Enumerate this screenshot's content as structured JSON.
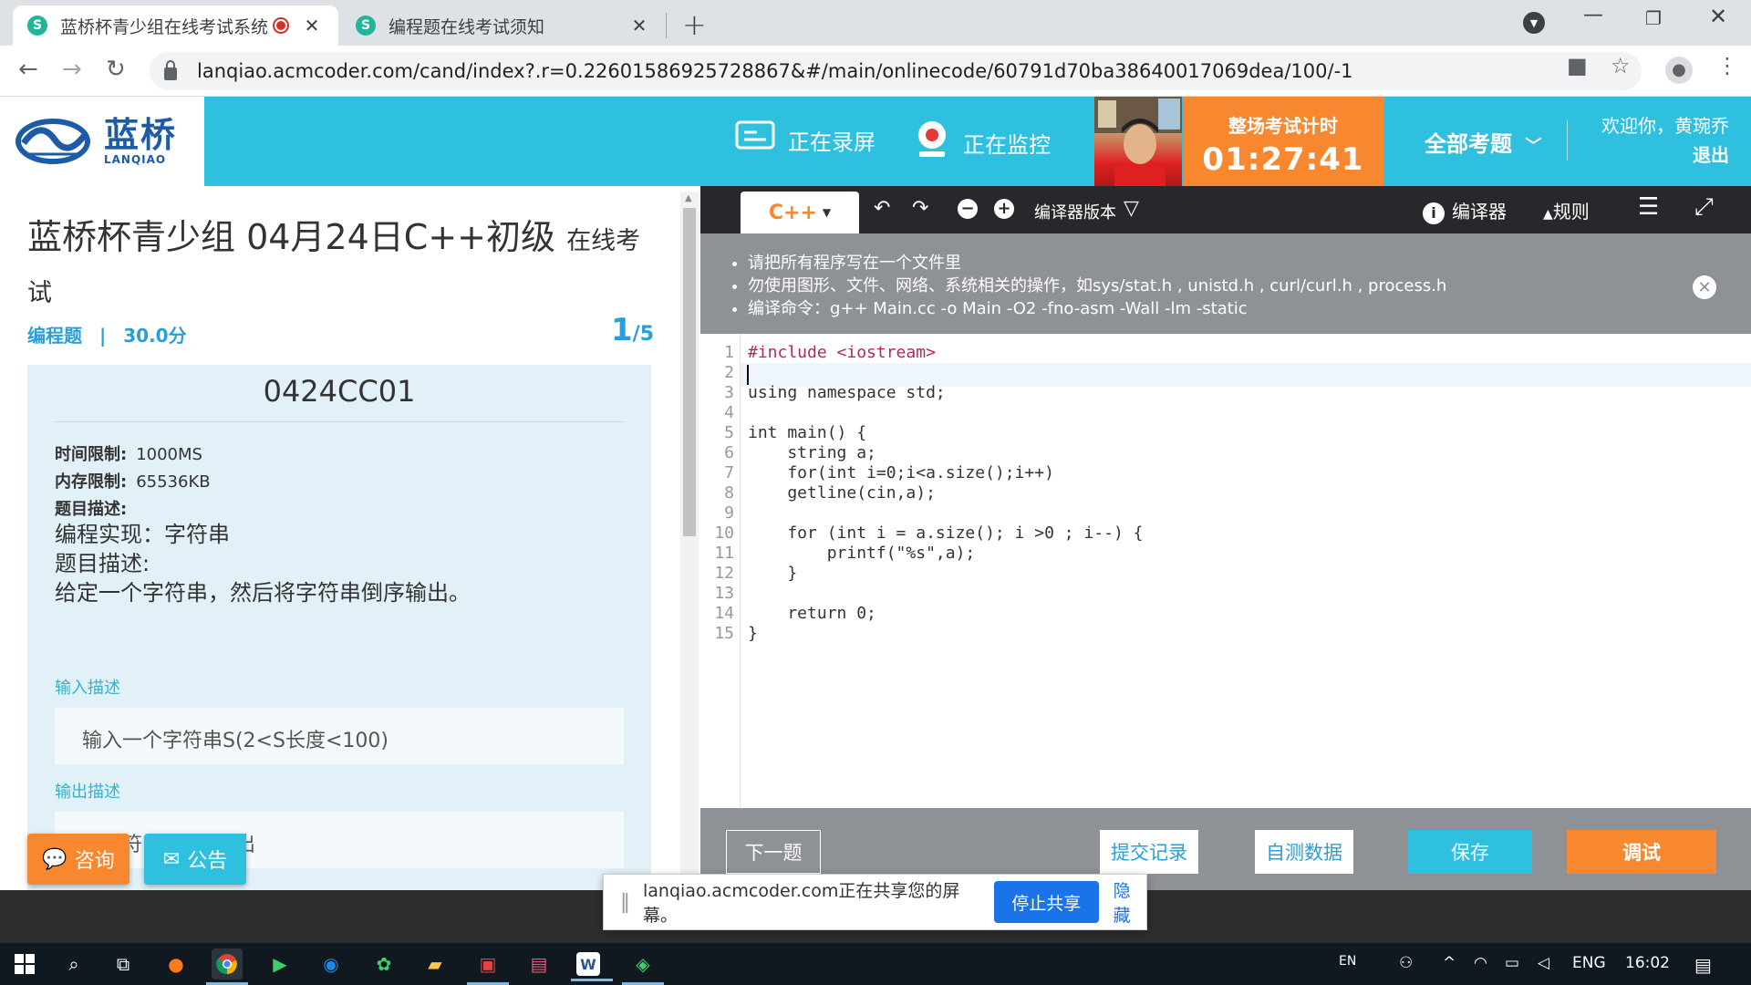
{
  "browser": {
    "tabs": [
      {
        "title": "蓝桥杯青少组在线考试系统"
      },
      {
        "title": "编程题在线考试须知"
      }
    ],
    "url": "lanqiao.acmcoder.com/cand/index?.r=0.22601586925728867&#/main/onlinecode/60791d70ba38640017069dea/100/-1"
  },
  "header": {
    "logo_cn": "蓝桥",
    "logo_en": "LANQIAO",
    "recording_label": "正在录屏",
    "monitoring_label": "正在监控",
    "timer_label": "整场考试计时",
    "timer_value": "01:27:41",
    "all_questions_label": "全部考题",
    "welcome_text": "欢迎你，黄琬乔",
    "logout_label": "退出"
  },
  "problem": {
    "title": "蓝桥杯青少组 04月24日C++初级",
    "title_suffix": "在线考试",
    "type": "编程题",
    "separator": "|",
    "score": "30.0分",
    "current": "1",
    "total": "/5",
    "code": "0424CC01",
    "time_limit_label": "时间限制:",
    "time_limit": "1000MS",
    "memory_limit_label": "内存限制:",
    "memory_limit": "65536KB",
    "desc_label": "题目描述:",
    "desc_lines": [
      "编程实现：字符串",
      "题目描述:",
      "给定一个字符串，然后将字符串倒序输出。"
    ],
    "input_label": "输入描述",
    "input_text": "输入一个字符串S(2<S长度<100)",
    "output_label": "输出描述",
    "output_text": "将字符串S倒序输出"
  },
  "float_buttons": {
    "consult": "咨询",
    "notice": "公告"
  },
  "editor": {
    "language": "C++",
    "compiler_version_label": "编译器版本",
    "compiler_label": "编译器",
    "rules_label": "规则",
    "notices": [
      "请把所有程序写在一个文件里",
      "勿使用图形、文件、网络、系统相关的操作，如sys/stat.h , unistd.h , curl/curl.h , process.h",
      "编译命令：g++ Main.cc -o Main -O2 -fno-asm -Wall -lm -static"
    ],
    "code_lines": [
      "#include <iostream>",
      "",
      "using namespace std;",
      "",
      "int main() {",
      "    string a;",
      "    for(int i=0;i<a.size();i++)",
      "    getline(cin,a);",
      "",
      "    for (int i = a.size(); i >0 ; i--) {",
      "        printf(\"%s\",a);",
      "    }",
      "",
      "    return 0;",
      "}"
    ],
    "footer": {
      "next": "下一题",
      "history": "提交记录",
      "selftest": "自测数据",
      "save": "保存",
      "debug": "调试"
    }
  },
  "sharebar": {
    "message": "lanqiao.acmcoder.com正在共享您的屏幕。",
    "stop": "停止共享",
    "hide": "隐藏"
  },
  "taskbar": {
    "ime": "EN",
    "lang": "ENG",
    "time": "16:02"
  },
  "colors": {
    "header": "#2fc0df",
    "timer": "#f7882f",
    "accent_blue": "#2a9fd6",
    "debug": "#f7882f"
  }
}
